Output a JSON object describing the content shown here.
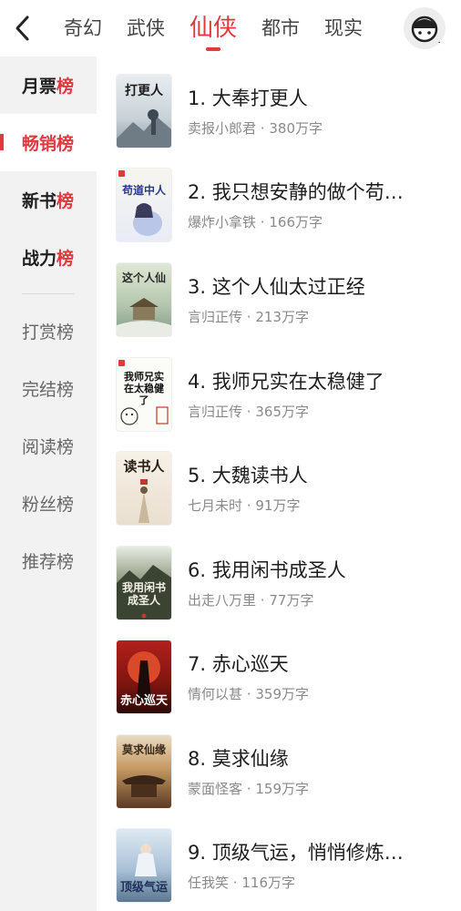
{
  "header": {
    "tabs": [
      {
        "label": "奇幻"
      },
      {
        "label": "武侠"
      },
      {
        "label": "仙侠"
      },
      {
        "label": "都市"
      },
      {
        "label": "现实"
      }
    ],
    "active_tab": "仙侠",
    "back_icon": "chevron-left-icon",
    "avatar_icon": "user-avatar-icon"
  },
  "sidebar": {
    "items": [
      {
        "main": "月票",
        "last": "榜"
      },
      {
        "main": "畅销",
        "last": "榜"
      },
      {
        "main": "新书",
        "last": "榜"
      },
      {
        "main": "战力",
        "last": "榜"
      },
      {
        "main": "打赏",
        "last": "榜"
      },
      {
        "main": "完结",
        "last": "榜"
      },
      {
        "main": "阅读",
        "last": "榜"
      },
      {
        "main": "粉丝",
        "last": "榜"
      },
      {
        "main": "推荐",
        "last": "榜"
      }
    ],
    "active_item": "畅销榜"
  },
  "books": [
    {
      "title": "1. 大奉打更人",
      "author": "卖报小郎君",
      "words": "380万字",
      "cover_text": "打更人"
    },
    {
      "title": "2. 我只想安静的做个苟…",
      "author": "爆炸小拿铁",
      "words": "166万字",
      "cover_text": "苟道中人"
    },
    {
      "title": "3. 这个人仙太过正经",
      "author": "言归正传",
      "words": "213万字",
      "cover_text": "这个人仙"
    },
    {
      "title": "4. 我师兄实在太稳健了",
      "author": "言归正传",
      "words": "365万字",
      "cover_text": "我师兄实在太稳健了"
    },
    {
      "title": "5. 大魏读书人",
      "author": "七月未时",
      "words": "91万字",
      "cover_text": "读书人"
    },
    {
      "title": "6. 我用闲书成圣人",
      "author": "出走八万里",
      "words": "77万字",
      "cover_text": "我用闲书成圣人"
    },
    {
      "title": "7. 赤心巡天",
      "author": "情何以甚",
      "words": "359万字",
      "cover_text": "赤心巡天"
    },
    {
      "title": "8. 莫求仙缘",
      "author": "蒙面怪客",
      "words": "159万字",
      "cover_text": "莫求仙缘"
    },
    {
      "title": "9. 顶级气运，悄悄修炼…",
      "author": "任我笑",
      "words": "116万字",
      "cover_text": "顶级气运"
    }
  ],
  "meta_separator": "·",
  "colors": {
    "accent": "#e03a3e",
    "sidebar_bg": "#f2f2f2",
    "meta_text": "#8a8a8a"
  }
}
